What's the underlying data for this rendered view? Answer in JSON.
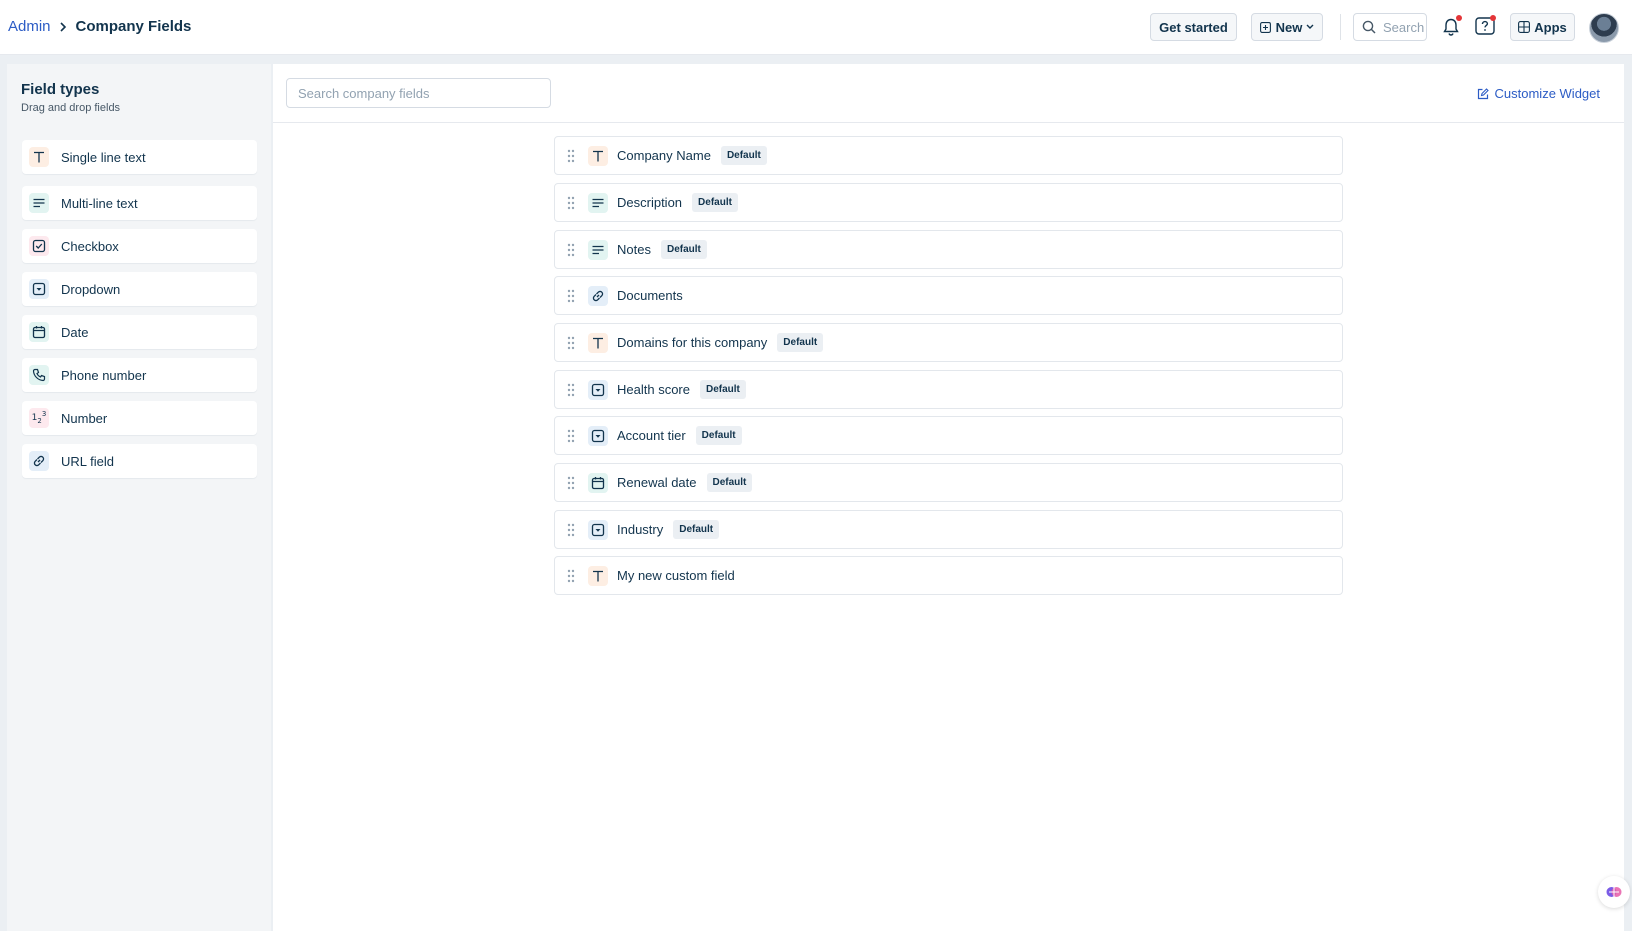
{
  "breadcrumb": {
    "parent": "Admin",
    "current": "Company Fields"
  },
  "topbar": {
    "get_started": "Get started",
    "new_label": "New",
    "search_placeholder": "Search",
    "apps_label": "Apps"
  },
  "sidebar": {
    "title": "Field types",
    "subtitle": "Drag and drop fields",
    "items": [
      {
        "label": "Single line text",
        "icon": "text-icon"
      },
      {
        "label": "Multi-line text",
        "icon": "multiline-icon"
      },
      {
        "label": "Checkbox",
        "icon": "checkbox-icon"
      },
      {
        "label": "Dropdown",
        "icon": "dropdown-icon"
      },
      {
        "label": "Date",
        "icon": "calendar-icon"
      },
      {
        "label": "Phone number",
        "icon": "phone-icon"
      },
      {
        "label": "Number",
        "icon": "number-icon"
      },
      {
        "label": "URL field",
        "icon": "link-icon"
      }
    ]
  },
  "main": {
    "search_placeholder": "Search company fields",
    "customize_label": "Customize Widget",
    "fields": [
      {
        "label": "Company Name",
        "badge": "Default",
        "icon": "text-icon"
      },
      {
        "label": "Description",
        "badge": "Default",
        "icon": "multiline-icon"
      },
      {
        "label": "Notes",
        "badge": "Default",
        "icon": "multiline-icon"
      },
      {
        "label": "Documents",
        "badge": "",
        "icon": "link-icon"
      },
      {
        "label": "Domains for this company",
        "badge": "Default",
        "icon": "text-icon"
      },
      {
        "label": "Health score",
        "badge": "Default",
        "icon": "dropdown-icon"
      },
      {
        "label": "Account tier",
        "badge": "Default",
        "icon": "dropdown-icon"
      },
      {
        "label": "Renewal date",
        "badge": "Default",
        "icon": "calendar-icon"
      },
      {
        "label": "Industry",
        "badge": "Default",
        "icon": "dropdown-icon"
      },
      {
        "label": "My new custom field",
        "badge": "",
        "icon": "text-icon"
      }
    ]
  },
  "colors": {
    "link": "#2c5cc5",
    "text": "#12344d",
    "notification_dot": "#e43538"
  }
}
